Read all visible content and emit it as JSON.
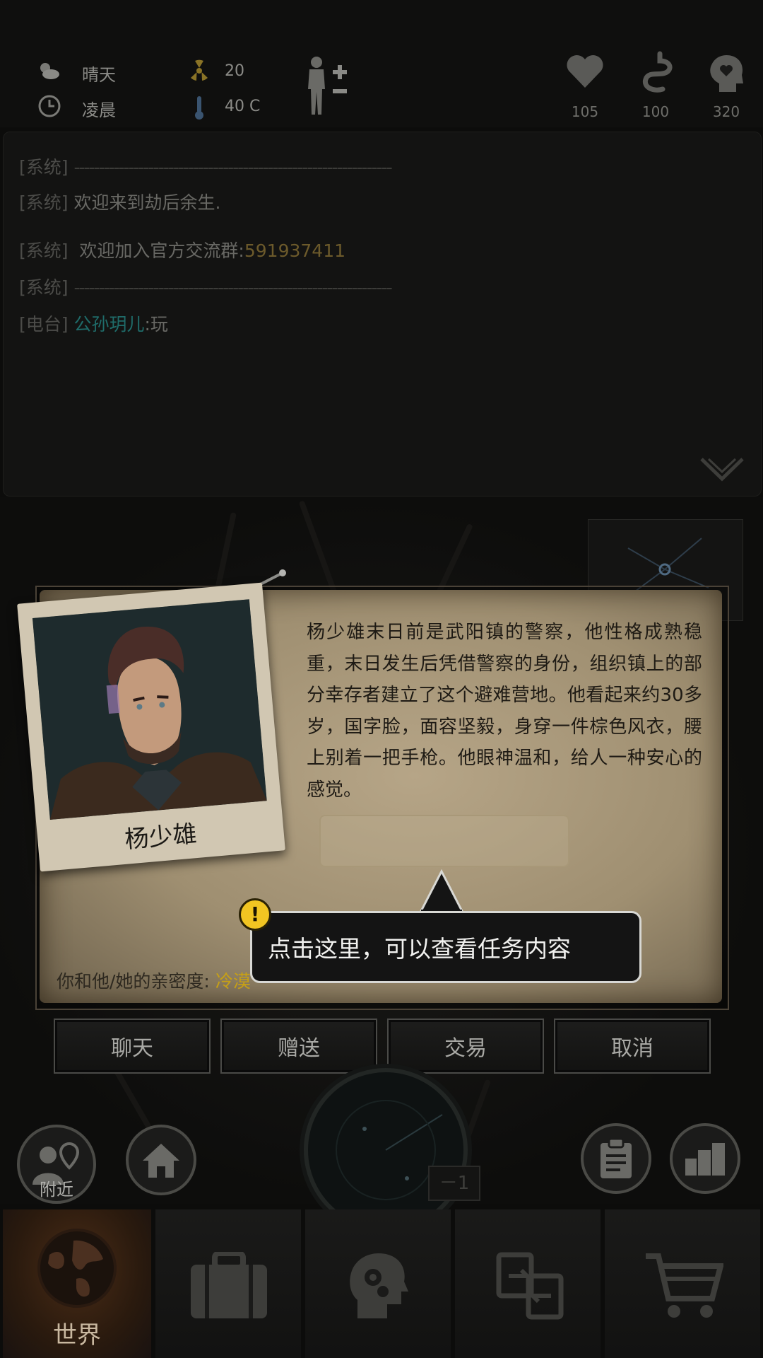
{
  "status": {
    "weather": "晴天",
    "time_of_day": "凌晨",
    "radiation": "20",
    "temperature": "40 C"
  },
  "vitals": [
    {
      "icon": "heart-icon",
      "value": "105"
    },
    {
      "icon": "stomach-icon",
      "value": "100"
    },
    {
      "icon": "mind-icon",
      "value": "320"
    }
  ],
  "chat": {
    "line1_tag": "[系统]",
    "line1_text": "----------------------------------------------------------------",
    "line2_tag": "[系统]",
    "line2_text": "欢迎来到劫后余生.",
    "line3_tag": "[系统]",
    "line3_text": "欢迎加入官方交流群:",
    "line3_group": "591937411",
    "line4_tag": "[系统]",
    "line4_text": "----------------------------------------------------------------",
    "line5_tag": "[电台]",
    "line5_user": "公孙玥儿",
    "line5_text": ":玩"
  },
  "npc": {
    "name": "杨少雄",
    "description": "杨少雄末日前是武阳镇的警察，他性格成熟稳重，末日发生后凭借警察的身份，组织镇上的部分幸存者建立了这个避难营地。他看起来约30多岁，国字脸，面容坚毅，身穿一件棕色风衣，腰上别着一把手枪。他眼神温和，给人一种安心的感觉。",
    "intimacy_label": "你和他/她的亲密度:",
    "intimacy_value": "冷漠"
  },
  "tooltip": {
    "text": "点击这里，可以查看任务内容"
  },
  "dialog_buttons": {
    "chat": "聊天",
    "gift": "赠送",
    "trade": "交易",
    "cancel": "取消"
  },
  "map": {
    "nearby_label": "附近",
    "radar_counter": "－1"
  },
  "nav": {
    "world_label": "世界"
  },
  "colors": {
    "accent_gold": "#c7a015",
    "teal_name": "#1f6c6a",
    "paper": "#b6a587"
  }
}
